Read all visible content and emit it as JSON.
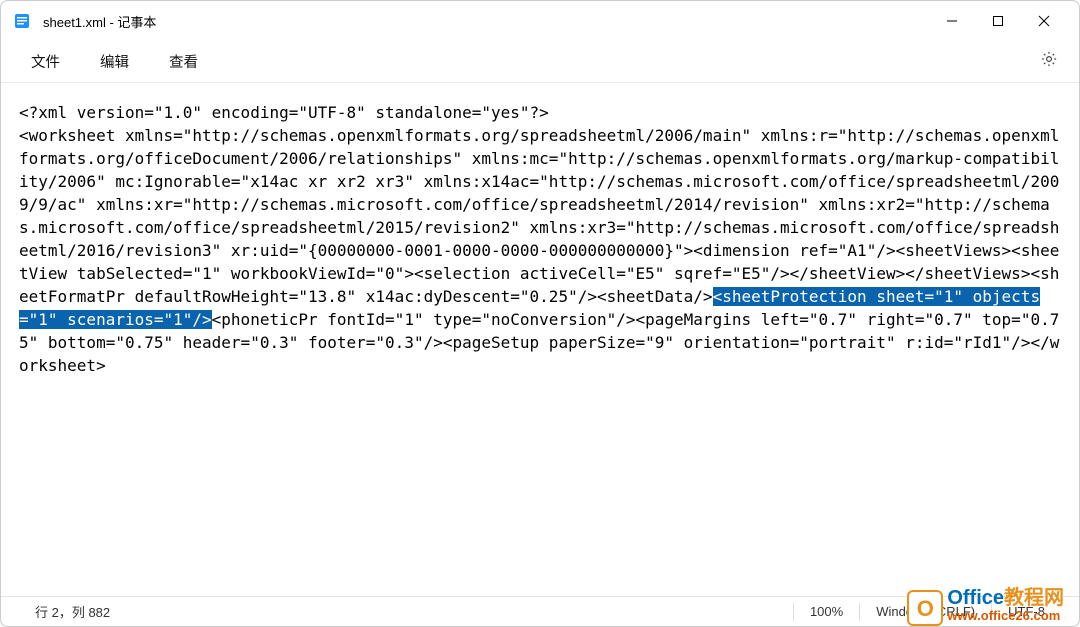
{
  "titlebar": {
    "title": "sheet1.xml - 记事本"
  },
  "menubar": {
    "file": "文件",
    "edit": "编辑",
    "view": "查看"
  },
  "content": {
    "pre": "<?xml version=\"1.0\" encoding=\"UTF-8\" standalone=\"yes\"?>\n<worksheet xmlns=\"http://schemas.openxmlformats.org/spreadsheetml/2006/main\" xmlns:r=\"http://schemas.openxmlformats.org/officeDocument/2006/relationships\" xmlns:mc=\"http://schemas.openxmlformats.org/markup-compatibility/2006\" mc:Ignorable=\"x14ac xr xr2 xr3\" xmlns:x14ac=\"http://schemas.microsoft.com/office/spreadsheetml/2009/9/ac\" xmlns:xr=\"http://schemas.microsoft.com/office/spreadsheetml/2014/revision\" xmlns:xr2=\"http://schemas.microsoft.com/office/spreadsheetml/2015/revision2\" xmlns:xr3=\"http://schemas.microsoft.com/office/spreadsheetml/2016/revision3\" xr:uid=\"{00000000-0001-0000-0000-000000000000}\"><dimension ref=\"A1\"/><sheetViews><sheetView tabSelected=\"1\" workbookViewId=\"0\"><selection activeCell=\"E5\" sqref=\"E5\"/></sheetView></sheetViews><sheetFormatPr defaultRowHeight=\"13.8\" x14ac:dyDescent=\"0.25\"/><sheetData/>",
    "highlight": "<sheetProtection sheet=\"1\" objects=\"1\" scenarios=\"1\"/>",
    "post": "<phoneticPr fontId=\"1\" type=\"noConversion\"/><pageMargins left=\"0.7\" right=\"0.7\" top=\"0.75\" bottom=\"0.75\" header=\"0.3\" footer=\"0.3\"/><pageSetup paperSize=\"9\" orientation=\"portrait\" r:id=\"rId1\"/></worksheet>"
  },
  "statusbar": {
    "cursor": "行 2，列 882",
    "zoom": "100%",
    "eol": "Windows (CRLF)",
    "encoding": "UTF-8"
  },
  "watermark": {
    "line1_blue": "Office",
    "line1_orange": "教程网",
    "line2": "www.office26.com"
  }
}
